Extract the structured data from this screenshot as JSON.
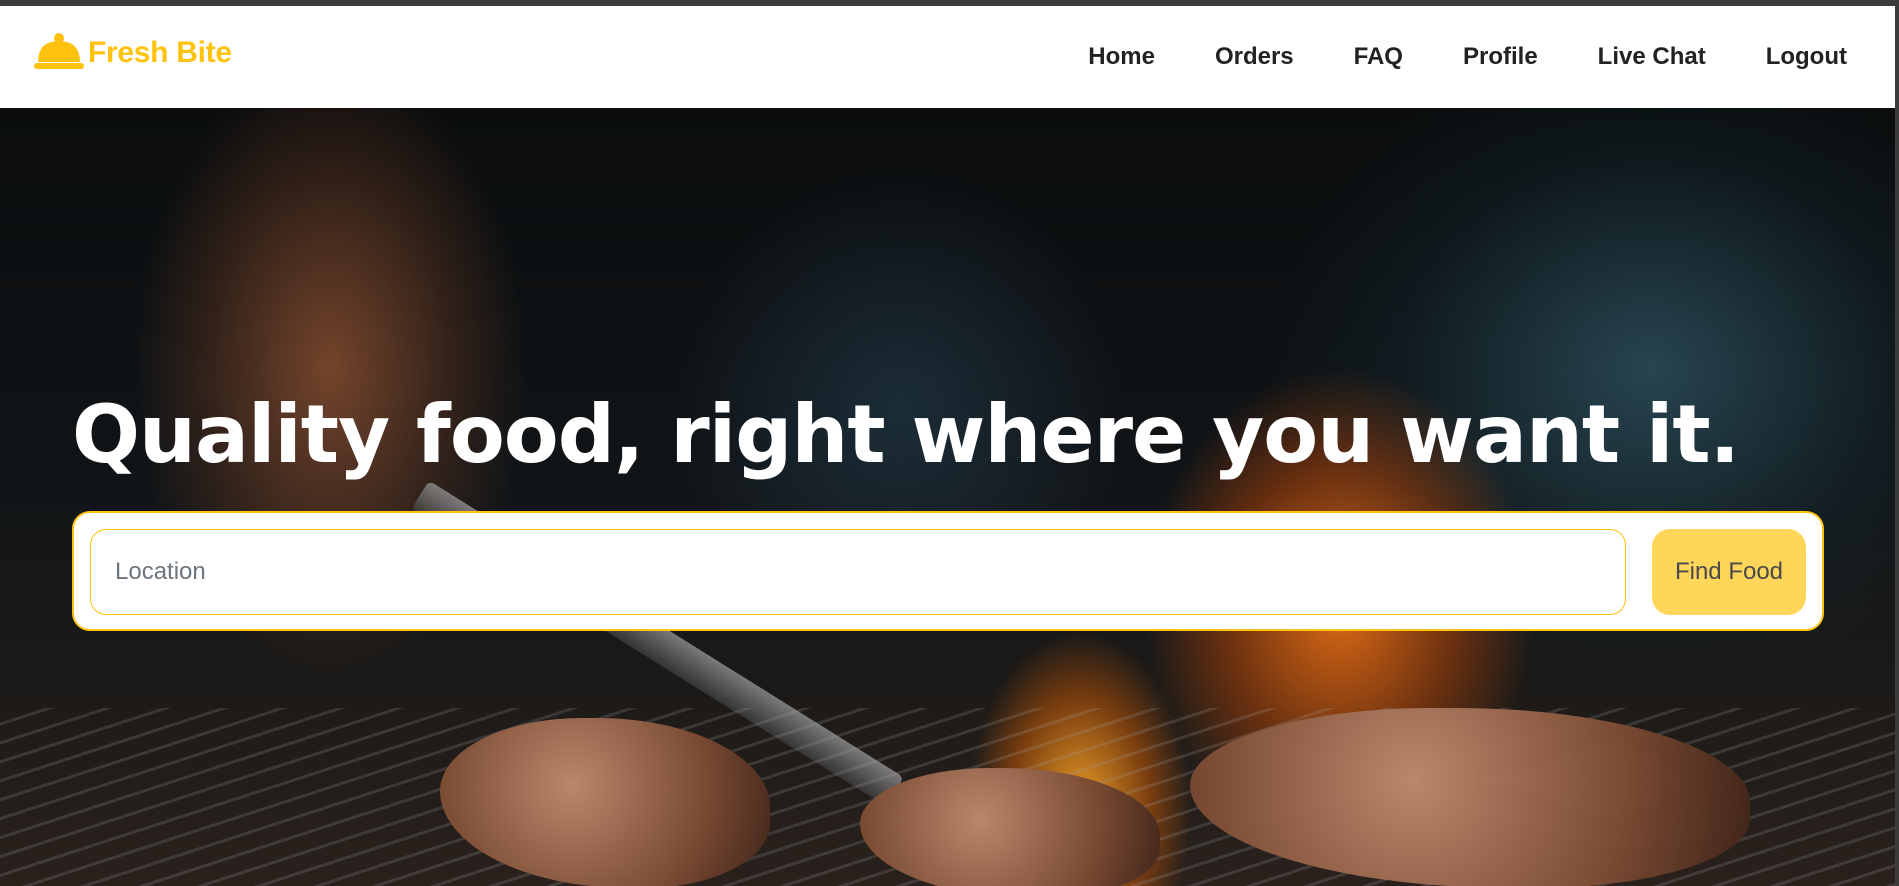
{
  "brand": {
    "name": "Fresh Bite",
    "icon": "cloche-icon",
    "accent_color": "#ffc20e"
  },
  "nav": {
    "items": [
      {
        "label": "Home"
      },
      {
        "label": "Orders"
      },
      {
        "label": "FAQ"
      },
      {
        "label": "Profile"
      },
      {
        "label": "Live Chat"
      },
      {
        "label": "Logout"
      }
    ]
  },
  "hero": {
    "headline": "Quality food, right where you want it.",
    "search": {
      "placeholder": "Location",
      "value": "",
      "button_label": "Find Food",
      "button_color": "#ffd65a"
    }
  }
}
